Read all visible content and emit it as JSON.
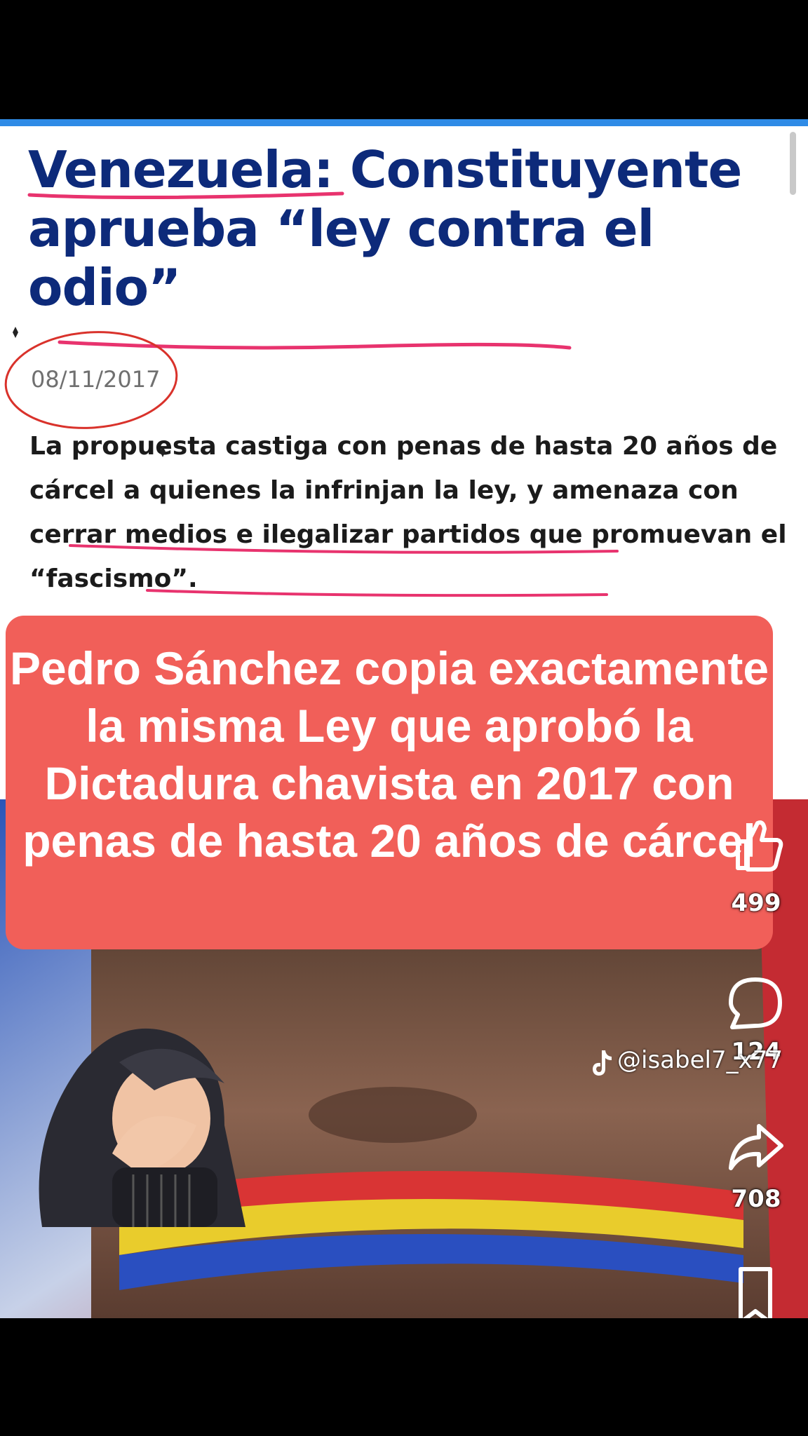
{
  "article": {
    "headline": "Venezuela: Constituyente aprueba “ley contra el odio”",
    "date": "08/11/2017",
    "lede": "La propuesta castiga con penas de hasta 20 años de cárcel a quienes la infrinjan la ley, y amenaza con cerrar medios e ilegalizar partidos que promuevan el “fascismo”."
  },
  "overlay": {
    "text": "Pedro Sánchez copia exactamente la misma Ley que aprobó la Dictadura chavista en 2017 con penas de  hasta 20 años de cárcel"
  },
  "actions": {
    "likes": "499",
    "comments": "124",
    "shares": "708"
  },
  "creator": {
    "handle": "@isabel7_x77"
  },
  "icons": {
    "like": "thumbs-up-icon",
    "comment": "comment-icon",
    "share": "share-arrow-icon",
    "save": "bookmark-icon",
    "tiktok": "tiktok-logo-icon"
  },
  "colors": {
    "headline": "#0d2a7a",
    "overlay": "#f15f59",
    "underline": "#e8336e",
    "accent_bar": "#2f8be6"
  }
}
